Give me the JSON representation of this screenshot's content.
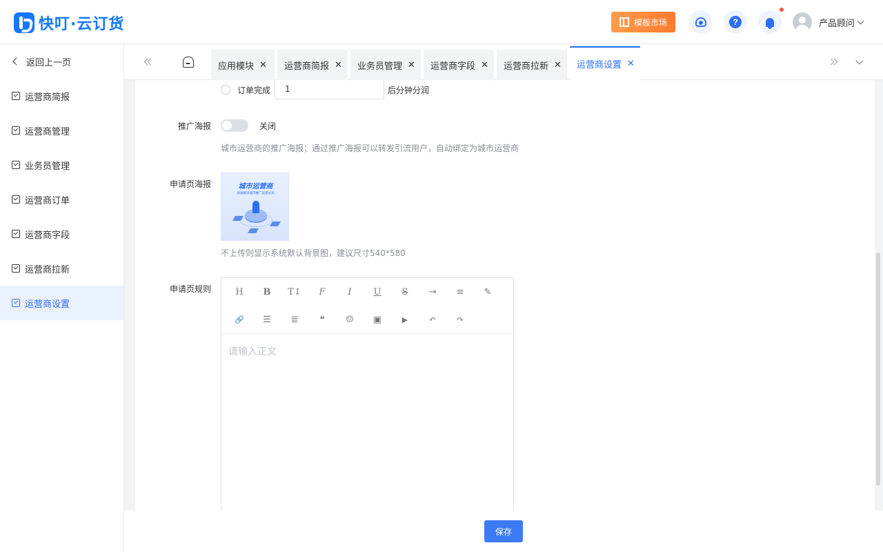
{
  "header": {
    "brand": "快叮·云订货",
    "market_label": "模板市场",
    "user_name": "产品顾问"
  },
  "sidebar": {
    "back_label": "返回上一页",
    "items": [
      {
        "label": "运营商简报"
      },
      {
        "label": "运营商管理"
      },
      {
        "label": "业务员管理"
      },
      {
        "label": "运营商订单"
      },
      {
        "label": "运营商字段"
      },
      {
        "label": "运营商拉新"
      },
      {
        "label": "运营商设置"
      }
    ],
    "active_index": 6
  },
  "tabs": [
    {
      "label": "应用模块"
    },
    {
      "label": "运营商简报"
    },
    {
      "label": "业务员管理"
    },
    {
      "label": "运营商字段"
    },
    {
      "label": "运营商拉新"
    },
    {
      "label": "运营商设置"
    }
  ],
  "form": {
    "order_complete_label": "订单完成",
    "order_minutes_value": "1",
    "after_minutes_label": "后分钟分润",
    "poster_label": "推广海报",
    "poster_toggle_state": "关闭",
    "poster_hint": "城市运营商的推广海报；通过推广海报可以转发引流用户，自动绑定为城市运营商",
    "apply_poster_label": "申请页海报",
    "poster_image_title": "城市运营商",
    "poster_image_subtitle": "快速解决城市推广运营分润",
    "apply_poster_hint": "不上传则显示系统默认背景图，建议尺寸540*580",
    "apply_rules_label": "申请页规则",
    "editor_placeholder": "请输入正文"
  },
  "editor_tools_row1": [
    {
      "glyph": "H",
      "name": "heading-icon"
    },
    {
      "glyph": "B",
      "name": "bold-icon"
    },
    {
      "glyph": "T↕",
      "name": "font-size-icon"
    },
    {
      "glyph": "F",
      "name": "font-family-icon"
    },
    {
      "glyph": "I",
      "name": "italic-icon"
    },
    {
      "glyph": "U",
      "name": "underline-icon"
    },
    {
      "glyph": "S",
      "name": "strikethrough-icon"
    },
    {
      "glyph": "⇥",
      "name": "indent-icon"
    },
    {
      "glyph": "≡",
      "name": "line-height-icon"
    },
    {
      "glyph": "✎",
      "name": "text-color-icon"
    }
  ],
  "editor_tools_row2": [
    {
      "glyph": "🔗",
      "name": "link-icon"
    },
    {
      "glyph": "☰",
      "name": "bulleted-list-icon"
    },
    {
      "glyph": "≣",
      "name": "align-icon"
    },
    {
      "glyph": "❝",
      "name": "quote-icon"
    },
    {
      "glyph": "☺",
      "name": "emoji-icon"
    },
    {
      "glyph": "▣",
      "name": "image-icon"
    },
    {
      "glyph": "▶",
      "name": "video-icon"
    },
    {
      "glyph": "↶",
      "name": "undo-icon"
    },
    {
      "glyph": "↷",
      "name": "redo-icon"
    }
  ],
  "footer": {
    "save_label": "保存"
  },
  "colors": {
    "primary": "#2d6ff5",
    "market_orange": "#ff8a3d",
    "notify_red": "#f5533d"
  }
}
